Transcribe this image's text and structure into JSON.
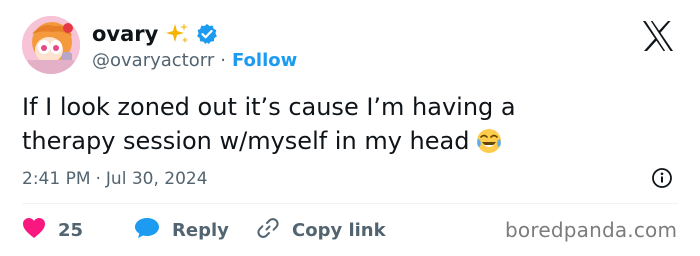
{
  "author": {
    "display_name": "ovary",
    "handle": "@ovaryactorr",
    "follow_label": "Follow",
    "sparkle": "✨",
    "avatar_icon": "powerpuff-girl-avatar",
    "verified_icon": "verified-badge-icon"
  },
  "tweet": {
    "line1": "If I look zoned out it’s cause I’m having a",
    "line2": "therapy session w/myself in my head",
    "emoji": "😂",
    "time": "2:41 PM",
    "date": "Jul 30, 2024"
  },
  "actions": {
    "like_count": "25",
    "reply_label": "Reply",
    "copy_link_label": "Copy link"
  },
  "watermark": "boredpanda.com",
  "colors": {
    "accent_blue": "#1d9bf0",
    "like_red": "#f91880",
    "text_primary": "#0f1419",
    "text_secondary": "#536471",
    "divider": "#eff3f4"
  }
}
